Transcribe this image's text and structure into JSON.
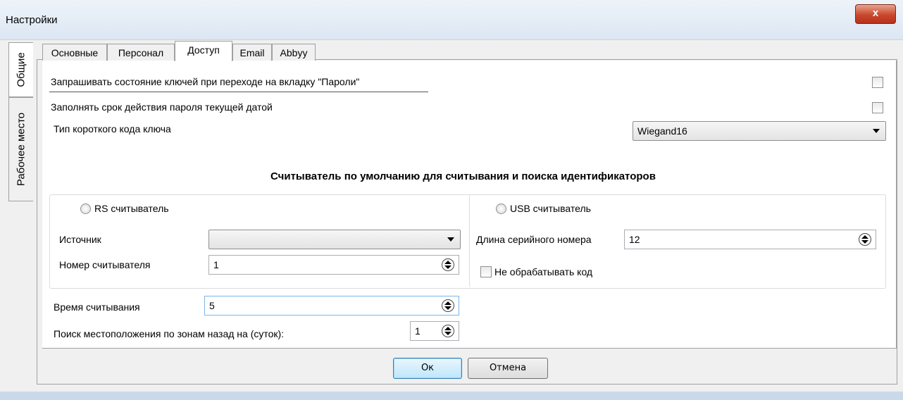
{
  "window": {
    "title": "Настройки",
    "close_label": "x"
  },
  "side_tabs": [
    "Общие",
    "Рабочее место"
  ],
  "tabs": [
    "Основные",
    "Персонал",
    "Доступ",
    "Email",
    "Abbyy"
  ],
  "access": {
    "query_keys_label": "Запрашивать состояние ключей при переходе на вкладку \"Пароли\"",
    "fill_expiry_label": "Заполнять срок действия пароля текущей датой",
    "short_code_label": "Тип короткого кода ключа",
    "short_code_value": "Wiegand16",
    "reader_heading": "Считыватель по умолчанию для считывания и поиска идентификаторов",
    "rs_reader_label": "RS считыватель",
    "source_label": "Источник",
    "source_value": "",
    "reader_number_label": "Номер считывателя",
    "reader_number_value": "1",
    "usb_reader_label": "USB считыватель",
    "serial_length_label": "Длина серийного номера",
    "serial_length_value": "12",
    "no_process_label": "Не обрабатывать код",
    "read_time_label": "Время считывания",
    "read_time_value": "5",
    "location_search_label": "Поиск местоположения по зонам назад на (суток):",
    "location_search_value": "1"
  },
  "buttons": {
    "ok": "Ок",
    "cancel": "Отмена"
  }
}
